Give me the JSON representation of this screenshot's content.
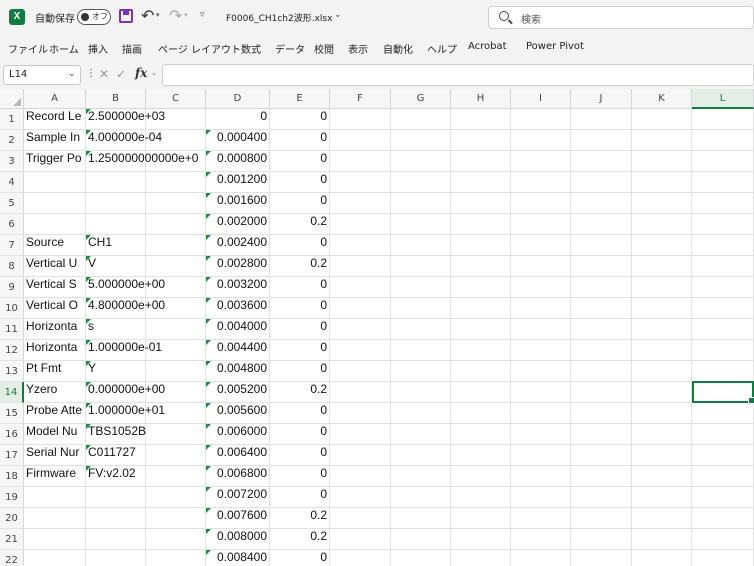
{
  "titlebar": {
    "app_icon": "excel-icon",
    "app_icon_letter": "X",
    "autosave_label": "自動保存",
    "autosave_state": "オフ",
    "filename": "F0006_CH1ch2波形.xlsx",
    "search_placeholder": "検索",
    "icons": [
      "save-icon",
      "undo-icon",
      "redo-icon",
      "customize-qat-icon",
      "search-icon"
    ]
  },
  "ribbon": {
    "tabs": [
      "ファイル",
      "ホーム",
      "挿入",
      "描画",
      "ページ レイアウト",
      "数式",
      "データ",
      "校閲",
      "表示",
      "自動化",
      "ヘルプ",
      "Acrobat",
      "Power Pivot"
    ]
  },
  "formula_bar": {
    "name_box": "L14",
    "fx_label": "fx",
    "content": ""
  },
  "sheet": {
    "columns": [
      "A",
      "B",
      "C",
      "D",
      "E",
      "F",
      "G",
      "H",
      "I",
      "J",
      "K",
      "L"
    ],
    "selected_column": "L",
    "selected_row": "14",
    "accent_color": "#107c41",
    "rows": [
      {
        "row": "1",
        "a": "Record Le",
        "b": "2.500000e+03",
        "d": "0",
        "e": "0"
      },
      {
        "row": "2",
        "a": "Sample In",
        "b": "4.000000e-04",
        "d": "0.000400",
        "e": "0"
      },
      {
        "row": "3",
        "a": "Trigger Po",
        "b": "1.250000000000e+0",
        "d": "0.000800",
        "e": "0"
      },
      {
        "row": "4",
        "a": "",
        "b": "",
        "d": "0.001200",
        "e": "0"
      },
      {
        "row": "5",
        "a": "",
        "b": "",
        "d": "0.001600",
        "e": "0"
      },
      {
        "row": "6",
        "a": "",
        "b": "",
        "d": "0.002000",
        "e": "0.2"
      },
      {
        "row": "7",
        "a": "Source",
        "b": "CH1",
        "d": "0.002400",
        "e": "0"
      },
      {
        "row": "8",
        "a": "Vertical U",
        "b": "V",
        "d": "0.002800",
        "e": "0.2"
      },
      {
        "row": "9",
        "a": "Vertical S",
        "b": "5.000000e+00",
        "d": "0.003200",
        "e": "0"
      },
      {
        "row": "10",
        "a": "Vertical O",
        "b": "4.800000e+00",
        "d": "0.003600",
        "e": "0"
      },
      {
        "row": "11",
        "a": "Horizonta",
        "b": "s",
        "d": "0.004000",
        "e": "0"
      },
      {
        "row": "12",
        "a": "Horizonta",
        "b": "1.000000e-01",
        "d": "0.004400",
        "e": "0"
      },
      {
        "row": "13",
        "a": "Pt Fmt",
        "b": "Y",
        "d": "0.004800",
        "e": "0"
      },
      {
        "row": "14",
        "a": "Yzero",
        "b": "0.000000e+00",
        "d": "0.005200",
        "e": "0.2"
      },
      {
        "row": "15",
        "a": "Probe Atte",
        "b": "1.000000e+01",
        "d": "0.005600",
        "e": "0"
      },
      {
        "row": "16",
        "a": "Model Nu",
        "b": "TBS1052B",
        "d": "0.006000",
        "e": "0"
      },
      {
        "row": "17",
        "a": "Serial Nur",
        "b": "C011727",
        "d": "0.006400",
        "e": "0"
      },
      {
        "row": "18",
        "a": "Firmware",
        "b": "FV:v2.02",
        "d": "0.006800",
        "e": "0"
      },
      {
        "row": "19",
        "a": "",
        "b": "",
        "d": "0.007200",
        "e": "0"
      },
      {
        "row": "20",
        "a": "",
        "b": "",
        "d": "0.007600",
        "e": "0.2"
      },
      {
        "row": "21",
        "a": "",
        "b": "",
        "d": "0.008000",
        "e": "0.2"
      },
      {
        "row": "22",
        "a": "",
        "b": "",
        "d": "0.008400",
        "e": "0"
      }
    ]
  }
}
